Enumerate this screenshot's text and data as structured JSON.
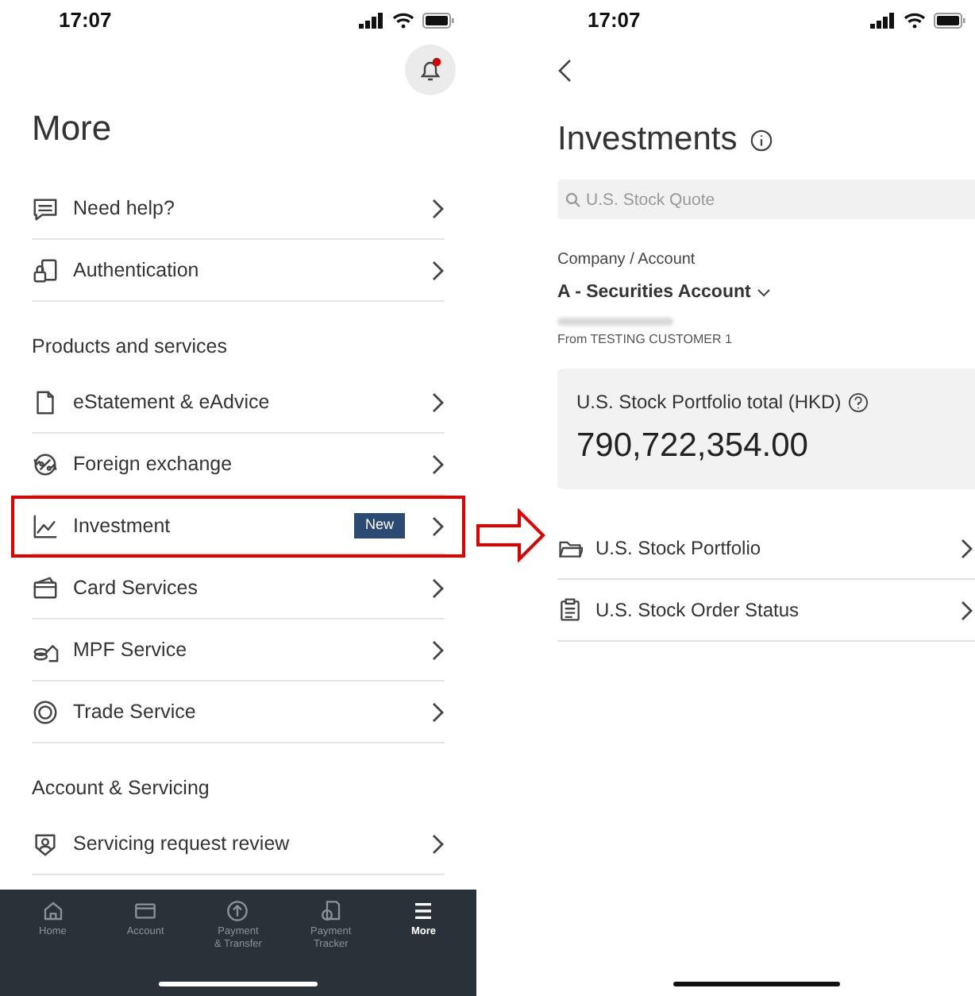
{
  "more_screen": {
    "status_bar": {
      "time": "17:07"
    },
    "title": "More",
    "sections": [
      {
        "items": [
          {
            "label": "Need help?",
            "highlighted": false
          },
          {
            "label": "Authentication",
            "highlighted": false
          }
        ]
      },
      {
        "heading": "Products and services",
        "items": [
          {
            "label": "eStatement & eAdvice",
            "highlighted": false
          },
          {
            "label": "Foreign exchange",
            "highlighted": false
          },
          {
            "label": "Investment",
            "badge": "New",
            "highlighted": true
          },
          {
            "label": "Card Services",
            "highlighted": false
          },
          {
            "label": "MPF Service",
            "highlighted": false
          },
          {
            "label": "Trade Service",
            "highlighted": false
          }
        ]
      },
      {
        "heading": "Account & Servicing",
        "items": [
          {
            "label": "Servicing request review",
            "highlighted": false
          }
        ]
      }
    ],
    "bottom_nav": [
      {
        "label": "Home",
        "selected": false
      },
      {
        "label": "Account",
        "selected": false
      },
      {
        "label": "Payment\n& Transfer",
        "selected": false
      },
      {
        "label": "Payment\nTracker",
        "selected": false
      },
      {
        "label": "More",
        "selected": true
      }
    ]
  },
  "investments_screen": {
    "status_bar": {
      "time": "17:07"
    },
    "title": "Investments",
    "search": {
      "placeholder": "U.S. Stock Quote"
    },
    "account": {
      "label": "Company / Account",
      "name": "A - Securities Account",
      "owner": "From TESTING CUSTOMER 1"
    },
    "portfolio_total": {
      "label": "U.S. Stock Portfolio total (HKD)",
      "value": "790,722,354.00"
    },
    "items": [
      {
        "label": "U.S. Stock Portfolio"
      },
      {
        "label": "U.S. Stock Order Status"
      }
    ]
  }
}
